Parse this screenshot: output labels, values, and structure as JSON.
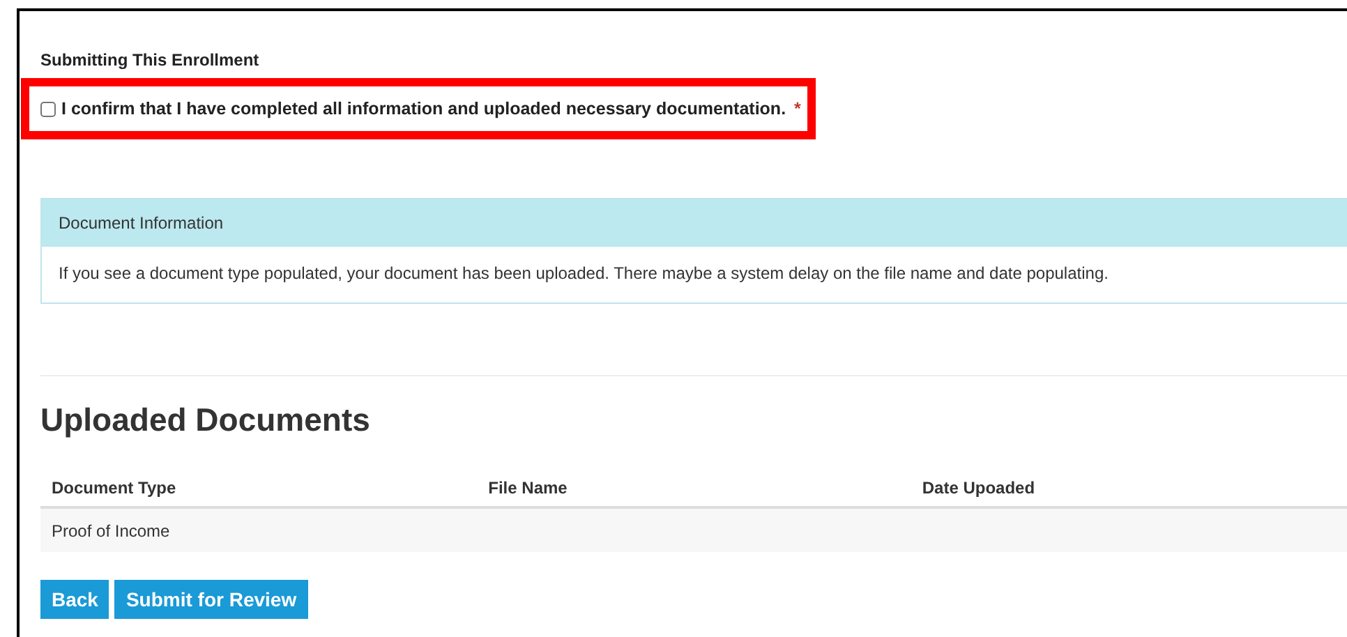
{
  "section_title": "Submitting This Enrollment",
  "confirmation": {
    "label": "I confirm that I have completed all information and uploaded necessary documentation.",
    "checked": false,
    "required_mark": "*",
    "highlighted": true
  },
  "info_panel": {
    "title": "Document Information",
    "body": "If you see a document type populated, your document has been uploaded. There maybe a system delay on the file name and date populating."
  },
  "uploaded_documents": {
    "title": "Uploaded Documents",
    "columns": [
      "Document Type",
      "File Name",
      "Date Upoaded"
    ],
    "rows": [
      [
        "Proof of Income",
        "",
        ""
      ]
    ]
  },
  "buttons": [
    "Back",
    "Submit for Review"
  ]
}
